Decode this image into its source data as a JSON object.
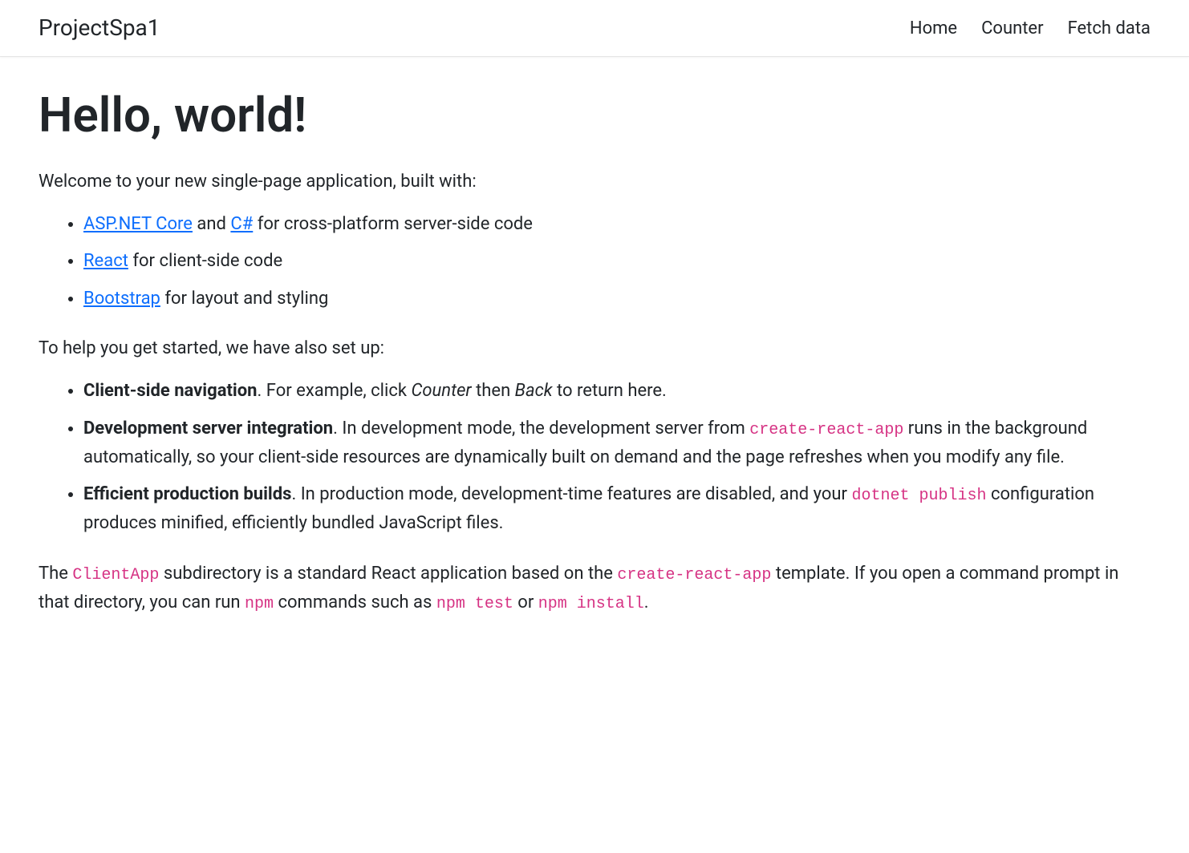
{
  "navbar": {
    "brand": "ProjectSpa1",
    "items": [
      {
        "label": "Home"
      },
      {
        "label": "Counter"
      },
      {
        "label": "Fetch data"
      }
    ]
  },
  "main": {
    "heading": "Hello, world!",
    "intro": "Welcome to your new single-page application, built with:",
    "tech_list": {
      "item0": {
        "link_aspnet": "ASP.NET Core",
        "text_and": " and ",
        "link_csharp": "C#",
        "text_after": " for cross-platform server-side code"
      },
      "item1": {
        "link_react": "React",
        "text_after": " for client-side code"
      },
      "item2": {
        "link_bootstrap": "Bootstrap",
        "text_after": " for layout and styling"
      }
    },
    "setup_intro": "To help you get started, we have also set up:",
    "setup_list": {
      "item0": {
        "strong": "Client-side navigation",
        "text1": ". For example, click ",
        "em1": "Counter",
        "text2": " then ",
        "em2": "Back",
        "text3": " to return here."
      },
      "item1": {
        "strong": "Development server integration",
        "text1": ". In development mode, the development server from ",
        "code1": "create-react-app",
        "text2": " runs in the background automatically, so your client-side resources are dynamically built on demand and the page refreshes when you modify any file."
      },
      "item2": {
        "strong": "Efficient production builds",
        "text1": ". In production mode, development-time features are disabled, and your ",
        "code1": "dotnet publish",
        "text2": " configuration produces minified, efficiently bundled JavaScript files."
      }
    },
    "footer_para": {
      "text1": "The ",
      "code1": "ClientApp",
      "text2": " subdirectory is a standard React application based on the ",
      "code2": "create-react-app",
      "text3": " template. If you open a command prompt in that directory, you can run ",
      "code3": "npm",
      "text4": " commands such as ",
      "code4": "npm test",
      "text5": " or ",
      "code5": "npm install",
      "text6": "."
    }
  }
}
